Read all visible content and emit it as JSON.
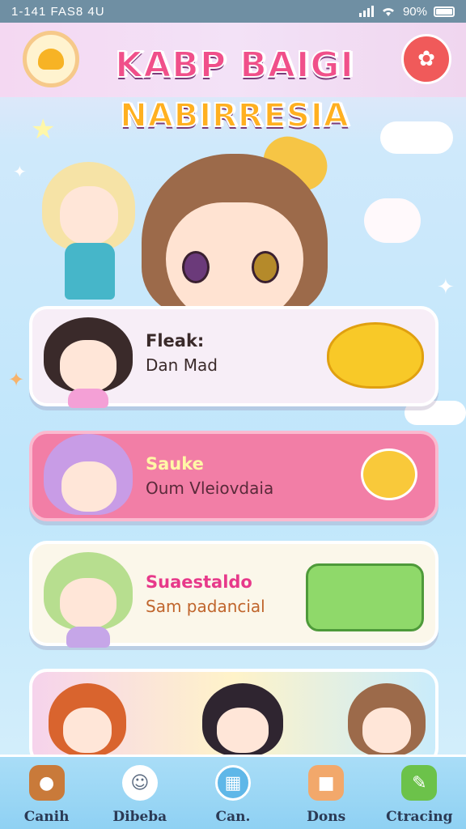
{
  "status_bar": {
    "left_text": "1-141 FAS8 4U",
    "battery_text": "90%",
    "battery_level": 0.9
  },
  "header": {
    "title_line1": "KABP BAIGI",
    "title_line2": "NABIRRESIA",
    "left_badge_icon": "bun-icon",
    "right_button_icon": "mascot-icon"
  },
  "cards": [
    {
      "title": "Fleak:",
      "subtitle": "Dan Mad",
      "mascot_icon": "yellow-blob-icon"
    },
    {
      "title": "Sauke",
      "subtitle": "Oum Vleiovdaia",
      "mascot_icon": "sun-mascot-icon"
    },
    {
      "title": "Suaestaldo",
      "subtitle": "Sam padancial",
      "mascot_icon": "green-box-icon"
    }
  ],
  "nav": [
    {
      "label": "Canih",
      "icon": "bread-icon",
      "color": "#c97a3a"
    },
    {
      "label": "Dibeba",
      "icon": "ghost-icon",
      "color": "#ffffff"
    },
    {
      "label": "Can.",
      "icon": "chart-icon",
      "color": "#5fb7e8"
    },
    {
      "label": "Dons",
      "icon": "box-icon",
      "color": "#f2a86b"
    },
    {
      "label": "Ctracing",
      "icon": "pencil-icon",
      "color": "#6cc24a"
    }
  ],
  "colors": {
    "accent_pink": "#f27ea6",
    "title_pink": "#f0508a",
    "status_bar": "#6f8fa3",
    "nav_bar": "#8fd1f3"
  }
}
